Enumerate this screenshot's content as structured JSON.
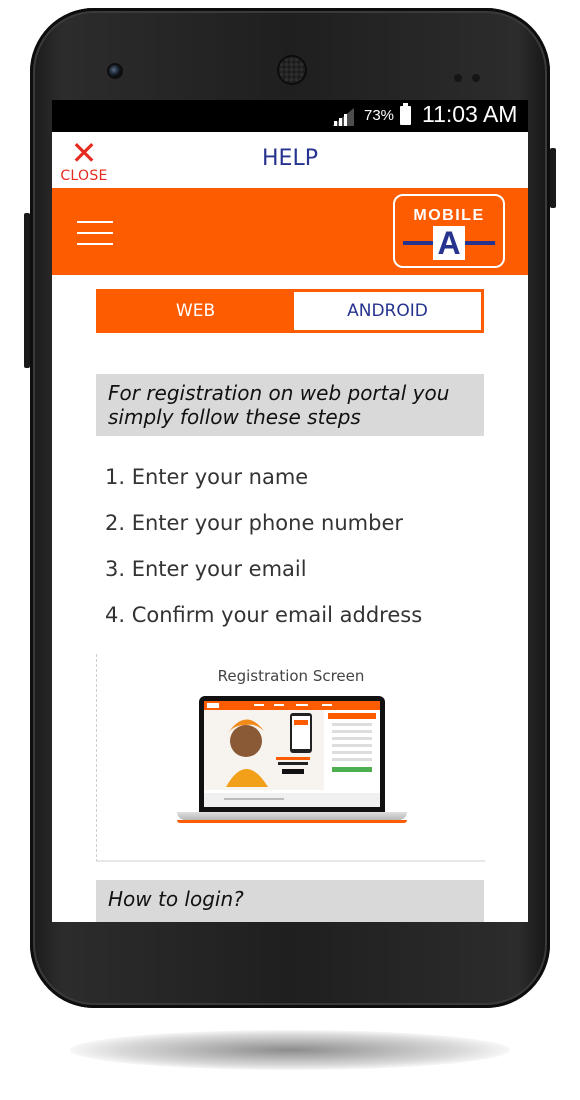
{
  "status_bar": {
    "battery_percent": "73%",
    "time": "11:03 AM"
  },
  "header": {
    "close_label": "CLOSE",
    "close_glyph": "✕",
    "title": "HELP"
  },
  "brand": {
    "logo_word": "MOBILE",
    "logo_letter": "A",
    "accent_color": "#fd5c00",
    "title_color": "#26338f"
  },
  "tabs": [
    {
      "label": "WEB",
      "selected": true
    },
    {
      "label": "ANDROID",
      "selected": false
    }
  ],
  "registration": {
    "heading": "For registration on web portal you simply follow these steps",
    "steps": [
      "1. Enter your name",
      "2. Enter your phone number",
      "3. Enter your email",
      "4. Confirm your email address"
    ],
    "screenshot_caption": "Registration Screen"
  },
  "login": {
    "heading": "How to login?"
  }
}
